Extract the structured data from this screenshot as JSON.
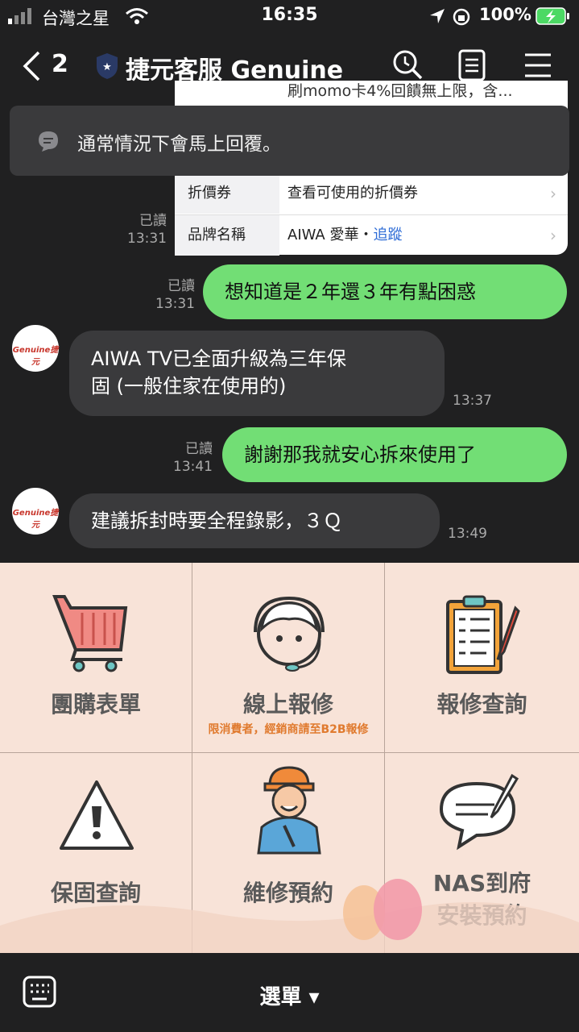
{
  "status_bar": {
    "carrier": "台灣之星",
    "time": "16:35",
    "battery": "100%"
  },
  "nav": {
    "back_count": "2",
    "title": "捷元客服 Genuine"
  },
  "product_card": {
    "rows": [
      {
        "key": "折價券",
        "value": "查看可使用的折價券"
      },
      {
        "key": "品牌名稱",
        "value": "AIWA 愛華・",
        "link": "追蹤"
      }
    ],
    "peek_text": "刷momo卡4%回饋無上限，含..."
  },
  "notice": {
    "text": "通常情況下會馬上回覆。"
  },
  "messages": [
    {
      "side": "card_meta",
      "read": "已讀",
      "time": "13:31"
    },
    {
      "side": "me",
      "text": "想知道是２年還３年有點困惑",
      "read": "已讀",
      "time": "13:31"
    },
    {
      "side": "them",
      "line1": "AIWA TV已全面升級為三年保",
      "line2": "固 (一般住家在使用的)",
      "time": "13:37"
    },
    {
      "side": "me",
      "text": "謝謝那我就安心拆來使用了",
      "read": "已讀",
      "time": "13:41"
    },
    {
      "side": "them",
      "line1": "建議拆封時要全程錄影，３Ｑ",
      "time": "13:49"
    }
  ],
  "avatar_logo": "Genuine捷元",
  "menu": [
    {
      "label": "團購表單",
      "icon": "shopping-cart-icon"
    },
    {
      "label": "線上報修",
      "sub": "限消費者，經銷商請至B2B報修",
      "icon": "headset-agent-icon"
    },
    {
      "label": "報修查詢",
      "icon": "clipboard-checklist-icon"
    },
    {
      "label": "保固查詢",
      "icon": "warning-triangle-icon"
    },
    {
      "label": "維修預約",
      "icon": "technician-icon"
    },
    {
      "label": "NAS到府",
      "label2": "安裝預約",
      "icon": "speech-bubble-pen-icon"
    }
  ],
  "bottom_bar": {
    "menu_label": "選單 ▾"
  },
  "colors": {
    "background": "#202021",
    "my_bubble": "#72de75",
    "their_bubble": "#3a3a3c",
    "menu_bg": "#f8e3d8",
    "link": "#2c6bd6"
  }
}
